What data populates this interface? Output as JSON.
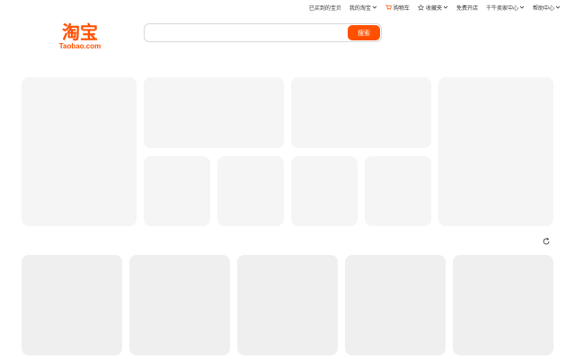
{
  "topbar": {
    "items": [
      {
        "label": "已买到的宝贝"
      },
      {
        "label": "我的淘宝"
      },
      {
        "label": "购物车"
      },
      {
        "label": "收藏夹"
      },
      {
        "label": "免费开店"
      },
      {
        "label": "千牛卖家中心"
      },
      {
        "label": "帮助中心"
      }
    ]
  },
  "header": {
    "logo_text": "淘宝",
    "logo_sub": "Taobao.com"
  },
  "search": {
    "placeholder": "",
    "value": "",
    "button_label": "搜索"
  },
  "icons": {
    "cart": "cart-icon",
    "favorites": "star-icon",
    "refresh": "refresh-icon",
    "dropdown": "chevron-down-icon"
  },
  "colors": {
    "brand": "#ff5000",
    "skeleton": "#f5f5f5"
  }
}
